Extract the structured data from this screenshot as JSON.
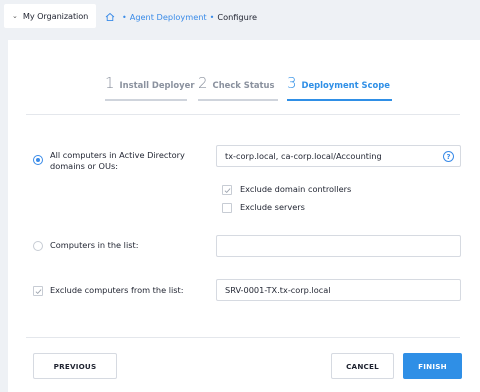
{
  "topbar": {
    "org_label": "My Organization",
    "breadcrumb": {
      "link": "Agent Deployment",
      "separator": "•",
      "current": "Configure"
    }
  },
  "steps": [
    {
      "num": "1",
      "label": "Install Deployer",
      "state": "done"
    },
    {
      "num": "2",
      "label": "Check Status",
      "state": "done"
    },
    {
      "num": "3",
      "label": "Deployment Scope",
      "state": "active"
    }
  ],
  "options": {
    "ad": {
      "label_line1": "All computers in Active Directory",
      "label_line2": "domains or OUs:",
      "value": "tx-corp.local, ca-corp.local/Accounting",
      "selected": true,
      "help": "?"
    },
    "exclude_dc": {
      "label": "Exclude domain controllers",
      "checked": true
    },
    "exclude_servers": {
      "label": "Exclude servers",
      "checked": false
    },
    "list": {
      "label": "Computers in the list:",
      "value": "",
      "selected": false
    },
    "exclude_list": {
      "label": "Exclude computers from the list:",
      "value": "SRV-0001-TX.tx-corp.local",
      "checked": true
    }
  },
  "buttons": {
    "previous": "PREVIOUS",
    "cancel": "CANCEL",
    "finish": "FINISH"
  },
  "colors": {
    "accent": "#2f8fe6",
    "background": "#eef1f5",
    "card": "#ffffff"
  }
}
